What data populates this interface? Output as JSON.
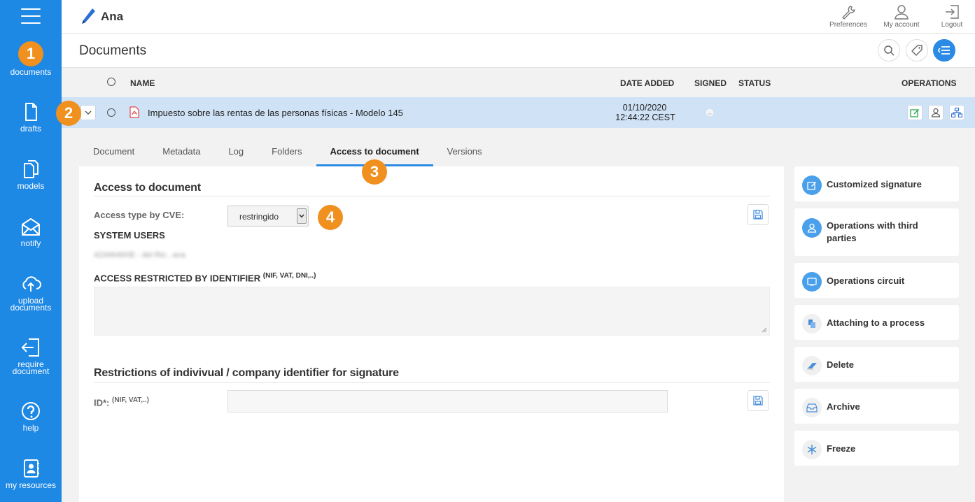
{
  "sidebar": {
    "items": [
      {
        "label": "documents"
      },
      {
        "label": "drafts"
      },
      {
        "label": "models"
      },
      {
        "label": "notify"
      },
      {
        "label_line1": "upload",
        "label_line2": "documents"
      },
      {
        "label_line1": "require",
        "label_line2": "document"
      },
      {
        "label": "help"
      },
      {
        "label": "my resources"
      }
    ]
  },
  "badges": [
    "1",
    "2",
    "3",
    "4"
  ],
  "header": {
    "user_name": "Ana",
    "actions": [
      {
        "label": "Preferences"
      },
      {
        "label": "My account"
      },
      {
        "label": "Logout"
      }
    ]
  },
  "page": {
    "title": "Documents"
  },
  "table": {
    "columns": {
      "name": "NAME",
      "date_added": "DATE ADDED",
      "signed": "SIGNED",
      "status": "STATUS",
      "operations": "OPERATIONS"
    },
    "row": {
      "name": "Impuesto sobre las rentas de las personas físicas - Modelo 145",
      "date": "01/10/2020",
      "time": "12:44:22 CEST"
    }
  },
  "tabs": [
    {
      "label": "Document"
    },
    {
      "label": "Metadata"
    },
    {
      "label": "Log"
    },
    {
      "label": "Folders"
    },
    {
      "label": "Access to document"
    },
    {
      "label": "Versions"
    }
  ],
  "access": {
    "section_title": "Access to document",
    "access_type_label": "Access type by CVE:",
    "access_type_value": "restringido",
    "system_users_label": "SYSTEM USERS",
    "system_users_value": "4234649/0E - del Rio , ana",
    "restricted_label": "ACCESS RESTRICTED BY IDENTIFIER",
    "restricted_hint": "(NIF, VAT, DNI,..)"
  },
  "restrictions": {
    "section_title": "Restrictions of indivivual / company identifier for signature",
    "id_label": "ID*:",
    "id_hint": "(NIF, VAT,..)"
  },
  "operations": [
    {
      "label": "Customized signature"
    },
    {
      "label_line1": "Operations with third",
      "label_line2": "parties"
    },
    {
      "label": "Operations circuit"
    },
    {
      "label": "Attaching to a process"
    },
    {
      "label": "Delete"
    },
    {
      "label": "Archive"
    },
    {
      "label": "Freeze"
    }
  ],
  "colors": {
    "sidebar": "#1e88e5",
    "accent": "#2b8ae6",
    "badge": "#f0901e",
    "row_selected": "#cfe2f6"
  }
}
